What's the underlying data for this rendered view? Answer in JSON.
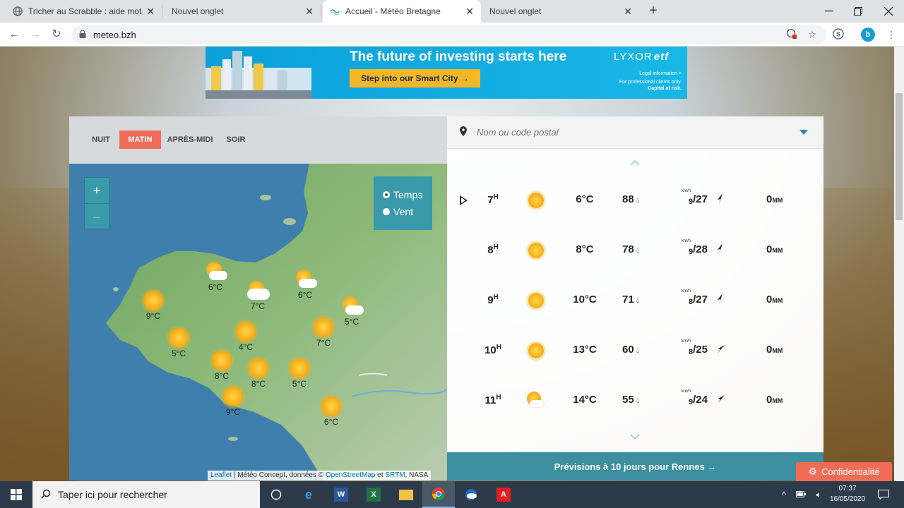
{
  "browser": {
    "tabs": [
      {
        "title": "Tricher au Scrabble : aide mots et",
        "icon": "globe-icon"
      },
      {
        "title": "Nouvel onglet",
        "icon": ""
      },
      {
        "title": "Accueil - Météo Bretagne",
        "icon": "meteo-favicon"
      },
      {
        "title": "Nouvel onglet",
        "icon": ""
      }
    ],
    "new_tab": "+",
    "url": "meteo.bzh"
  },
  "ad": {
    "headline": "The future of investing starts here",
    "cta": "Step into our Smart City →",
    "brand": "LYXOR",
    "brand_suffix": "etf",
    "legal1": "Legal information >",
    "legal2": "For professional clients only.",
    "legal3": "Capital at risk."
  },
  "periods": {
    "night": "NUIT",
    "morning": "MATIN",
    "afternoon": "APRÈS-MIDI",
    "evening": "SOIR",
    "selected": "MATIN"
  },
  "map": {
    "zoom_in": "+",
    "zoom_out": "–",
    "layers": {
      "temp": "Temps",
      "wind": "Vent",
      "selected": "Temps"
    },
    "markers": [
      {
        "temp": "6°C",
        "icon": "sun-cloud"
      },
      {
        "temp": "7°C",
        "icon": "cloud-sun"
      },
      {
        "temp": "6°C",
        "icon": "sun-cloud"
      },
      {
        "temp": "9°C",
        "icon": "sun"
      },
      {
        "temp": "5°C",
        "icon": "sun-cloud"
      },
      {
        "temp": "4°C",
        "icon": "sun"
      },
      {
        "temp": "7°C",
        "icon": "sun"
      },
      {
        "temp": "5°C",
        "icon": "sun"
      },
      {
        "temp": "8°C",
        "icon": "sun"
      },
      {
        "temp": "8°C",
        "icon": "sun"
      },
      {
        "temp": "5°C",
        "icon": "sun"
      },
      {
        "temp": "9°C",
        "icon": "sun"
      },
      {
        "temp": "6°C",
        "icon": "sun"
      }
    ],
    "attribution": {
      "leaflet": "Leaflet",
      "sep": "|",
      "text1": "Météo Concept, données ©",
      "osm": "OpenStreetMap",
      "et": "et",
      "srtm": "SRTM",
      "text2": ", NASA"
    }
  },
  "forecast": {
    "search_placeholder": "Nom ou code postal",
    "rows": [
      {
        "hour": "7",
        "temp": "6°C",
        "humidity": "88",
        "gust": "9",
        "wind": "/27",
        "rain": "0",
        "icon": "sun"
      },
      {
        "hour": "8",
        "temp": "8°C",
        "humidity": "78",
        "gust": "9",
        "wind": "/28",
        "rain": "0",
        "icon": "sun"
      },
      {
        "hour": "9",
        "temp": "10°C",
        "humidity": "71",
        "gust": "8",
        "wind": "/27",
        "rain": "0",
        "icon": "sun"
      },
      {
        "hour": "10",
        "temp": "13°C",
        "humidity": "60",
        "gust": "8",
        "wind": "/25",
        "rain": "0",
        "icon": "sun"
      },
      {
        "hour": "11",
        "temp": "14°C",
        "humidity": "55",
        "gust": "9",
        "wind": "/24",
        "rain": "0",
        "icon": "sun-cloud"
      }
    ],
    "hour_unit": "H",
    "wind_unit": "km/h",
    "rain_unit": "MM",
    "ten_day": "Prévisions à 10 jours pour Rennes →"
  },
  "privacy": "Confidentialité",
  "taskbar": {
    "search_placeholder": "Taper ici pour rechercher",
    "time": "07:37",
    "date": "16/05/2020"
  }
}
